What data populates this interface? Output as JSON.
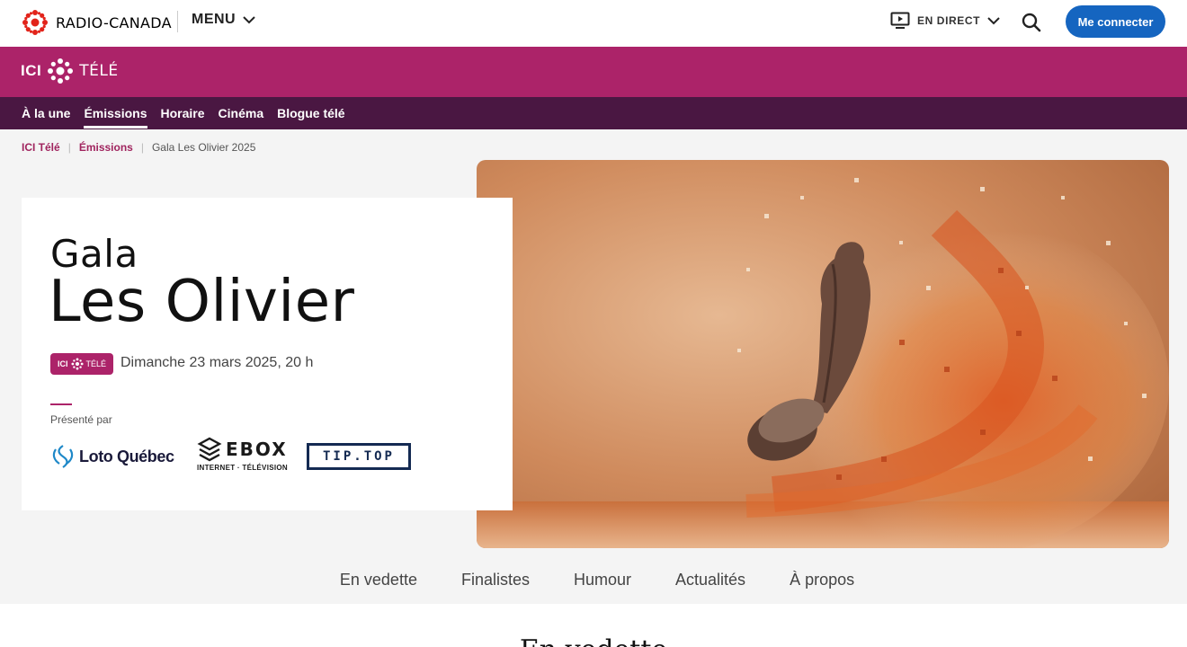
{
  "header": {
    "brand": "RADIO-CANADA",
    "menu_label": "MENU",
    "live_label": "EN DIRECT",
    "login_label": "Me connecter"
  },
  "section_brand": {
    "ici": "ICI",
    "tele": "TÉLÉ"
  },
  "section_nav": {
    "items": [
      {
        "label": "À la une"
      },
      {
        "label": "Émissions"
      },
      {
        "label": "Horaire"
      },
      {
        "label": "Cinéma"
      },
      {
        "label": "Blogue télé"
      }
    ],
    "active": "Émissions"
  },
  "breadcrumb": {
    "items": [
      "ICI Télé",
      "Émissions"
    ],
    "current": "Gala Les Olivier 2025"
  },
  "show": {
    "title_line1": "Gala",
    "title_line2": "Les Olivier",
    "badge_ici": "ICI",
    "badge_tele": "TÉLÉ",
    "air_date": "Dimanche 23 mars 2025, 20 h",
    "presented_by": "Présenté par",
    "sponsors": {
      "loto": "Loto Québec",
      "ebox": "EBOX",
      "ebox_tagline": "INTERNET · TÉLÉVISION",
      "tiptop": "TIP.TOP"
    }
  },
  "sub_tabs": [
    "En vedette",
    "Finalistes",
    "Humour",
    "Actualités",
    "À propos"
  ],
  "section_heading": "En vedette",
  "colors": {
    "brand_magenta": "#ac2369",
    "nav_dark": "#4a1742",
    "login_blue": "#1565c0",
    "rc_red": "#e2231a"
  },
  "icons": [
    "radio-canada-gem-icon",
    "chevron-down-icon",
    "live-tv-icon",
    "search-icon",
    "ici-gem-icon",
    "loto-quebec-icon",
    "ebox-icon"
  ]
}
